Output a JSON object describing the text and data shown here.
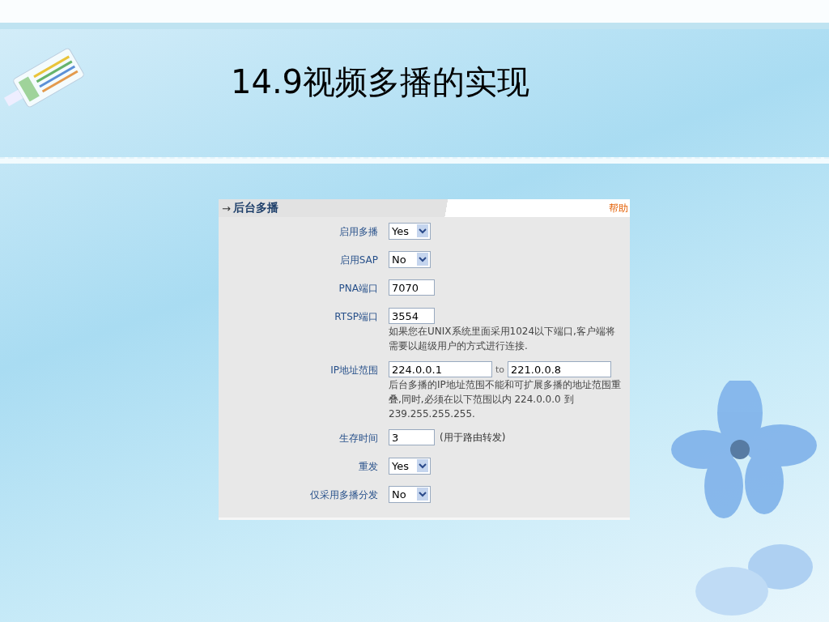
{
  "slide": {
    "title": "14.9视频多播的实现"
  },
  "panel": {
    "arrow": "→",
    "title": "后台多播",
    "help": "帮助",
    "rows": [
      {
        "kind": "select",
        "label": "启用多播",
        "value": "Yes"
      },
      {
        "kind": "select",
        "label": "启用SAP",
        "value": "No"
      },
      {
        "kind": "text",
        "label": "PNA端口",
        "value": "7070"
      },
      {
        "kind": "text",
        "label": "RTSP端口",
        "value": "3554",
        "note": "如果您在UNIX系统里面采用1024以下端口,客户端将需要以超级用户的方式进行连接."
      },
      {
        "kind": "range",
        "label": "IP地址范围",
        "value": "224.0.0.1",
        "joiner": "to",
        "value_to": "221.0.0.8",
        "note": "后台多播的IP地址范围不能和可扩展多播的地址范围重叠,同时,必须在以下范围以内 224.0.0.0 到 239.255.255.255."
      },
      {
        "kind": "text",
        "label": "生存时间",
        "value": "3",
        "suffix": "(用于路由转发)"
      },
      {
        "kind": "select",
        "label": "重发",
        "value": "Yes"
      },
      {
        "kind": "select",
        "label": "仅采用多播分发",
        "value": "No"
      }
    ]
  }
}
